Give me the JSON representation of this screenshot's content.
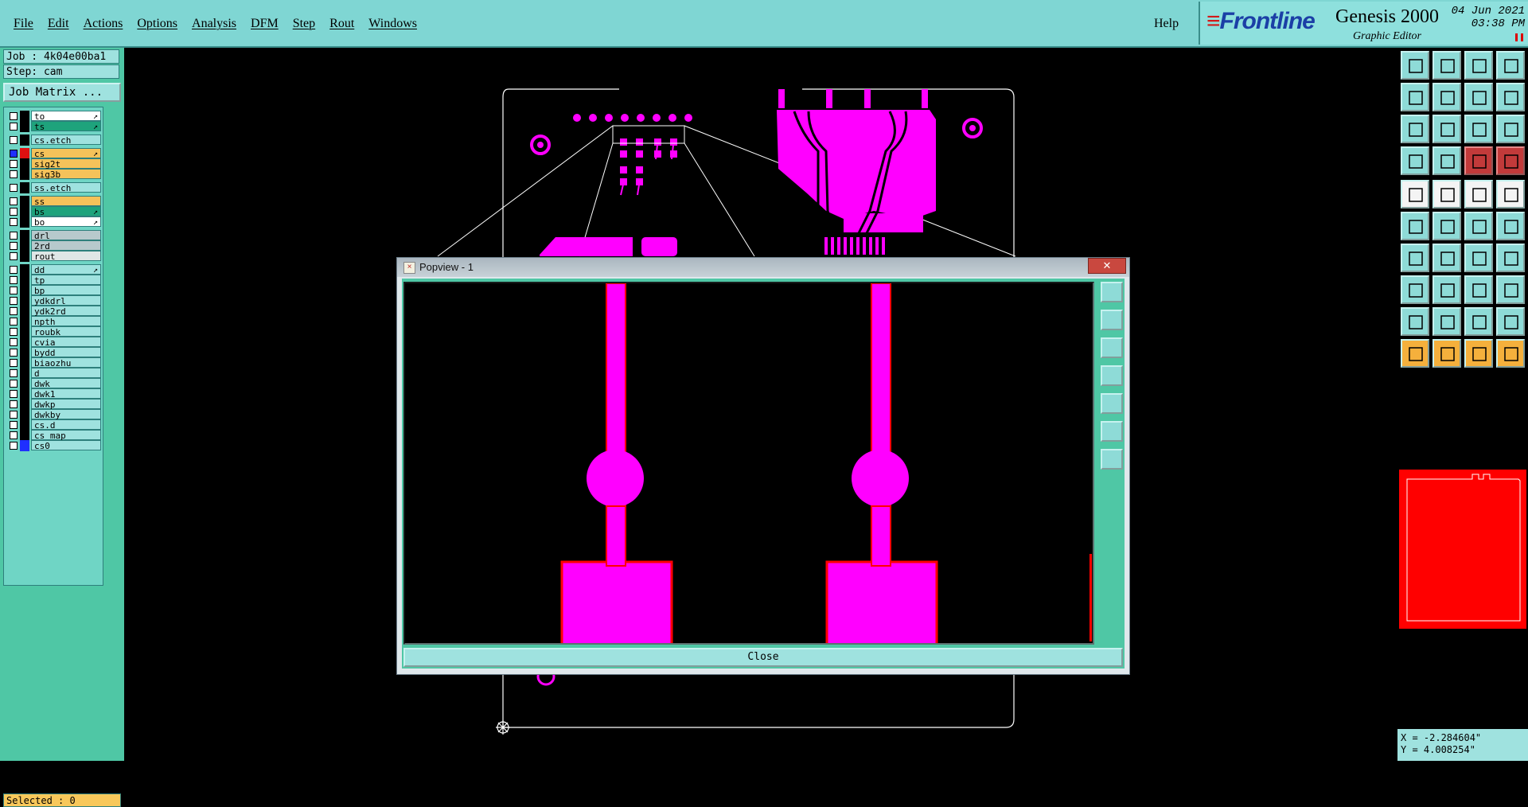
{
  "menubar": {
    "items": [
      "File",
      "Edit",
      "Actions",
      "Options",
      "Analysis",
      "DFM",
      "Step",
      "Rout",
      "Windows"
    ],
    "help": "Help"
  },
  "brand": {
    "logo": "Frontline",
    "product": "Genesis 2000",
    "subtitle": "Graphic Editor",
    "date": "04 Jun 2021",
    "time": "03:38 PM"
  },
  "left": {
    "job": "Job : 4k04e00ba1",
    "step": "Step: cam",
    "job_matrix": "Job Matrix ...",
    "selected": "Selected : 0"
  },
  "layers": [
    {
      "name": "to",
      "bg": "#ffffff",
      "arrow": true
    },
    {
      "name": "ts",
      "bg": "#1ea37c",
      "arrow": true
    },
    {
      "name": "cs.etch",
      "bg": "#9fe2df",
      "arrow": false
    },
    {
      "name": "cs",
      "bg": "#f5c25a",
      "arrow": true,
      "swatch": "#e01010",
      "active": true
    },
    {
      "name": "sig2t",
      "bg": "#f5c25a",
      "arrow": false
    },
    {
      "name": "sig3b",
      "bg": "#f5c25a",
      "arrow": false
    },
    {
      "name": "ss.etch",
      "bg": "#9fe2df",
      "arrow": false
    },
    {
      "name": "ss",
      "bg": "#f5c25a",
      "arrow": false
    },
    {
      "name": "bs",
      "bg": "#1ea37c",
      "arrow": true
    },
    {
      "name": "bo",
      "bg": "#ffffff",
      "arrow": true
    },
    {
      "name": "drl",
      "bg": "#b7c9cc",
      "arrow": false
    },
    {
      "name": "2rd",
      "bg": "#b7c9cc",
      "arrow": false
    },
    {
      "name": "rout",
      "bg": "#dfe6e6",
      "arrow": false
    },
    {
      "name": "dd",
      "bg": "#9fe2df",
      "arrow": true
    },
    {
      "name": "tp",
      "bg": "#9fe2df",
      "arrow": false
    },
    {
      "name": "bp",
      "bg": "#9fe2df",
      "arrow": false
    },
    {
      "name": "ydkdrl",
      "bg": "#9fe2df",
      "arrow": false
    },
    {
      "name": "ydk2rd",
      "bg": "#9fe2df",
      "arrow": false
    },
    {
      "name": "npth",
      "bg": "#9fe2df",
      "arrow": false
    },
    {
      "name": "roubk",
      "bg": "#9fe2df",
      "arrow": false
    },
    {
      "name": "cvia",
      "bg": "#9fe2df",
      "arrow": false
    },
    {
      "name": "bydd",
      "bg": "#9fe2df",
      "arrow": false
    },
    {
      "name": "biaozhu",
      "bg": "#9fe2df",
      "arrow": false
    },
    {
      "name": "d",
      "bg": "#9fe2df",
      "arrow": false
    },
    {
      "name": "dwk",
      "bg": "#9fe2df",
      "arrow": false
    },
    {
      "name": "dwk1",
      "bg": "#9fe2df",
      "arrow": false
    },
    {
      "name": "dwkp",
      "bg": "#9fe2df",
      "arrow": false
    },
    {
      "name": "dwkby",
      "bg": "#9fe2df",
      "arrow": false
    },
    {
      "name": "cs.d",
      "bg": "#9fe2df",
      "arrow": false
    },
    {
      "name": "cs_map",
      "bg": "#9fe2df",
      "arrow": false
    },
    {
      "name": "cs0",
      "bg": "#9fe2df",
      "arrow": false,
      "swatch": "#1f2fff"
    }
  ],
  "popview": {
    "title": "Popview - 1",
    "close_x": "✕",
    "close_label": "Close"
  },
  "coords": {
    "x": "X = -2.284604\"",
    "y": "Y = 4.008254\""
  },
  "colors": {
    "copper": "#ff00ff",
    "outline": "#ff0000",
    "panel": "#4fc7a5",
    "menubar": "#7fd6d3"
  }
}
